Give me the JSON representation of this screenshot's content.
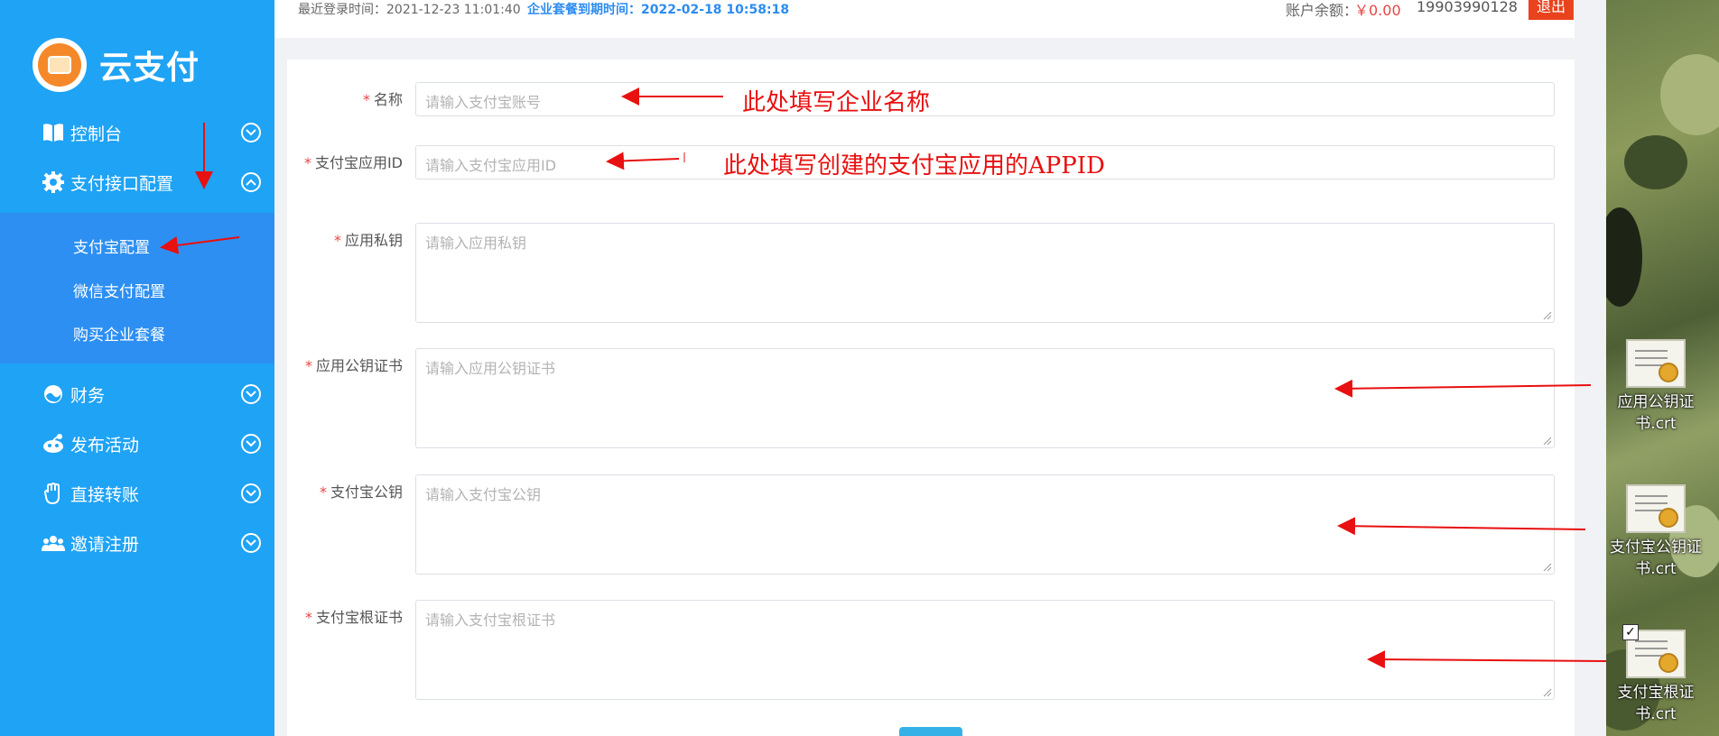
{
  "sidebar": {
    "logo_text": "云支付",
    "items": [
      {
        "label": "控制台",
        "icon": "book-icon"
      },
      {
        "label": "支付接口配置",
        "icon": "gear-icon"
      },
      {
        "label": "财务",
        "icon": "wallet-icon"
      },
      {
        "label": "发布活动",
        "icon": "activity-icon"
      },
      {
        "label": "直接转账",
        "icon": "hand-icon"
      },
      {
        "label": "邀请注册",
        "icon": "users-icon"
      }
    ],
    "submenu": [
      {
        "label": "支付宝配置"
      },
      {
        "label": "微信支付配置"
      },
      {
        "label": "购买企业套餐"
      }
    ]
  },
  "topbar": {
    "last_login": "最近登录时间：2021-12-23 11:01:40",
    "expire": "企业套餐到期时间：2022-02-18 10:58:18",
    "balance_label": "账户余额：",
    "balance_value": "￥0.00",
    "phone": "19903990128",
    "logout": "退出"
  },
  "form": {
    "fields": [
      {
        "label": "名称",
        "placeholder": "请输入支付宝账号"
      },
      {
        "label": "支付宝应用ID",
        "placeholder": "请输入支付宝应用ID"
      },
      {
        "label": "应用私钥",
        "placeholder": "请输入应用私钥"
      },
      {
        "label": "应用公钥证书",
        "placeholder": "请输入应用公钥证书"
      },
      {
        "label": "支付宝公钥",
        "placeholder": "请输入支付宝公钥"
      },
      {
        "label": "支付宝根证书",
        "placeholder": "请输入支付宝根证书"
      }
    ],
    "required_mark": "*"
  },
  "annotations": {
    "name_note": "此处填写企业名称",
    "appid_note": "此处填写创建的支付宝应用的APPID"
  },
  "desktop": {
    "icons": [
      {
        "label": "应用公钥证书.crt"
      },
      {
        "label": "支付宝公钥证书.crt"
      },
      {
        "label": "支付宝根证书.crt"
      }
    ]
  },
  "colors": {
    "sidebar": "#1fa3f5",
    "submenu": "#2d8ff2",
    "accent": "#e81010",
    "logout": "#e8431d",
    "link": "#2d8cf0"
  }
}
